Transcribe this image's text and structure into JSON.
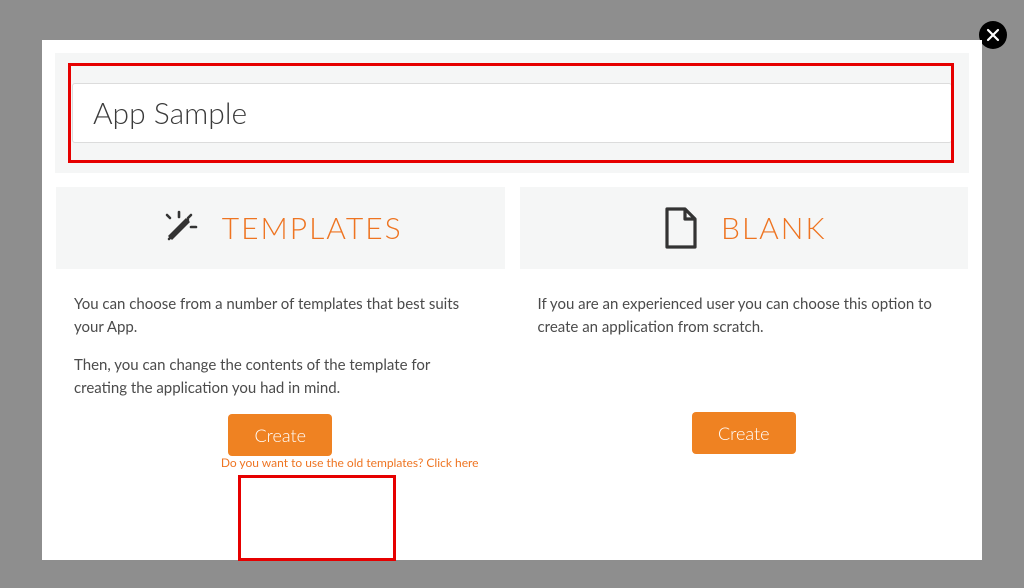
{
  "input": {
    "value": "App Sample"
  },
  "templates": {
    "title": "TEMPLATES",
    "desc1": "You can choose from a number of templates that best suits your App.",
    "desc2": "Then, you can change the contents of the template for creating the application you had in mind.",
    "button": "Create",
    "old_link": "Do you want to use the old templates? Click here"
  },
  "blank": {
    "title": "BLANK",
    "desc1": "If you are an experienced user you can choose this option to create an application from scratch.",
    "button": "Create"
  }
}
